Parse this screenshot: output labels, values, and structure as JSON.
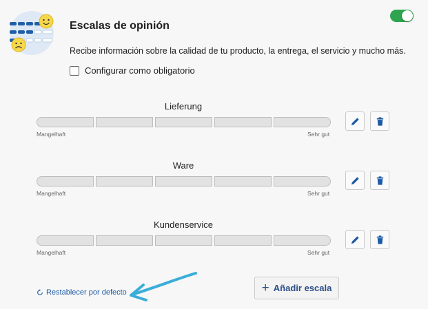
{
  "header": {
    "title": "Escalas de opinión",
    "description": "Recibe información sobre la calidad de tu producto, la entrega, el servicio y mucho más.",
    "toggle_on": true,
    "mandatory_label": "Configurar como obligatorio",
    "mandatory_checked": false
  },
  "scales": [
    {
      "title": "Lieferung",
      "low_label": "Mangelhaft",
      "high_label": "Sehr gut"
    },
    {
      "title": "Ware",
      "low_label": "Mangelhaft",
      "high_label": "Sehr gut"
    },
    {
      "title": "Kundenservice",
      "low_label": "Mangelhaft",
      "high_label": "Sehr gut"
    }
  ],
  "footer": {
    "reset_label": "Restablecer por defecto",
    "add_label": "Añadir escala"
  },
  "icons": {
    "edit": "pencil-icon",
    "delete": "trash-icon",
    "reset": "refresh-icon",
    "add": "plus-icon"
  },
  "colors": {
    "accent": "#1d5aa6",
    "toggle": "#2ea44f",
    "arrow": "#3aaed8"
  }
}
